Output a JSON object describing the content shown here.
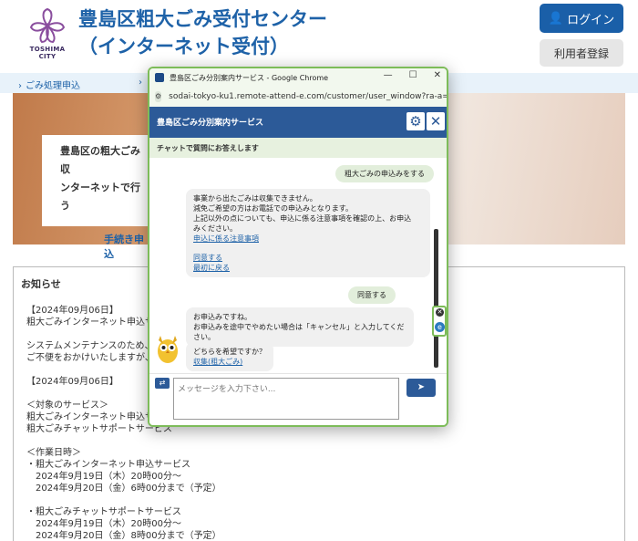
{
  "site": {
    "logo_text": "TOSHIMA CITY",
    "title_line1": "豊島区粗大ごみ受付センター",
    "title_line2": "（インターネット受付）",
    "login_label": "ログイン",
    "register_label": "利用者登録",
    "breadcrumb": [
      "ごみ処理申込",
      ""
    ],
    "hero_text_line1": "豊島区の粗大ごみ収",
    "hero_text_line2": "ンターネットで行う",
    "hero_link": "手続き申込",
    "notice": {
      "title": "お知らせ",
      "body": "【2024年09月06日】\n粗大ごみインターネット申込サ\n\nシステムメンテナンスのため、下\nご不便をおかけいたしますが、何\n\n【2024年09月06日】\n\n＜対象のサービス＞\n粗大ごみインターネット申込サー\n粗大ごみチャットサポートサービス\n\n＜作業日時＞\n・粗大ごみインターネット申込サービス\n　2024年9月19日（木）20時00分～\n　2024年9月20日（金）6時00分まで（予定）\n\n・粗大ごみチャットサポートサービス\n　2024年9月19日（木）20時00分～\n　2024年9月20日（金）8時00分まで（予定）"
    }
  },
  "popup": {
    "window_title": "豊島区ごみ分別案内サービス - Google Chrome",
    "url": "sodai-tokyo-ku1.remote-attend-e.com/customer/user_window?ra-a=...",
    "chat_title": "豊島区ごみ分別案内サービス",
    "chat_subtitle": "チャットで質問にお答えします",
    "messages": {
      "user1": "粗大ごみの申込みをする",
      "bot1_lines": "事業から出たごみは収集できません。\n減免ご希望の方はお電話での申込みとなります。\n上記以外の点についても、申込に係る注意事項を確認の上、お申込\nみください。",
      "bot1_link": "申込に係る注意事項",
      "bot1_agree": "同意する",
      "bot1_back": "最初に戻る",
      "user2": "同意する",
      "bot2": "お申込みですね。\nお申込みを途中でやめたい場合は「キャンセル」と入力してください。",
      "bot3_q": "どちらを希望ですか？",
      "bot3_link": "収集(粗大ごみ)"
    },
    "input_placeholder": "メッセージを入力下さい...",
    "colors": {
      "header_blue": "#2c5a98",
      "border_green": "#7dbc59",
      "site_blue": "#1e62a8"
    }
  }
}
